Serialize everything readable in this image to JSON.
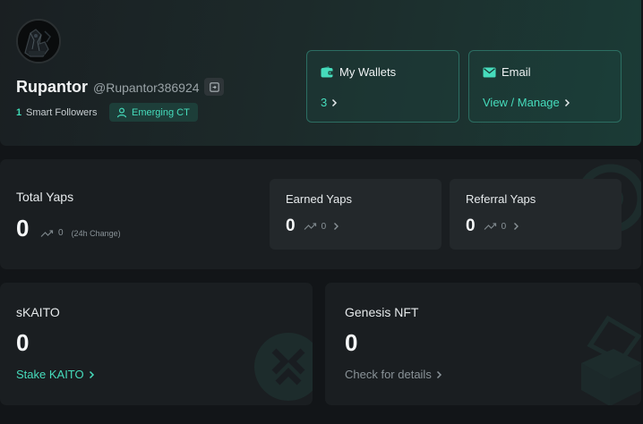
{
  "profile": {
    "username": "Rupantor",
    "handle": "@Rupantor386924",
    "smart_followers_count": "1",
    "smart_followers_label": "Smart Followers",
    "badge_label": "Emerging CT"
  },
  "wallets": {
    "title": "My Wallets",
    "value": "3"
  },
  "email": {
    "title": "Email",
    "link": "View / Manage"
  },
  "yaps": {
    "total_label": "Total Yaps",
    "total_value": "0",
    "total_change": "0",
    "change_period": "(24h Change)",
    "earned_label": "Earned Yaps",
    "earned_value": "0",
    "earned_change": "0",
    "referral_label": "Referral Yaps",
    "referral_value": "0",
    "referral_change": "0"
  },
  "skaito": {
    "title": "sKAITO",
    "value": "0",
    "link": "Stake KAITO"
  },
  "genesis": {
    "title": "Genesis NFT",
    "value": "0",
    "link": "Check for details"
  },
  "colors": {
    "accent": "#46dcbc",
    "background": "#121518",
    "panel": "#1a1e21",
    "sub_card": "#23282b",
    "muted_text": "#8a9398"
  },
  "icons": [
    "avatar",
    "copy-icon",
    "user-icon",
    "wallet-icon",
    "mail-icon",
    "chevron-right-icon",
    "trend-up-icon"
  ]
}
